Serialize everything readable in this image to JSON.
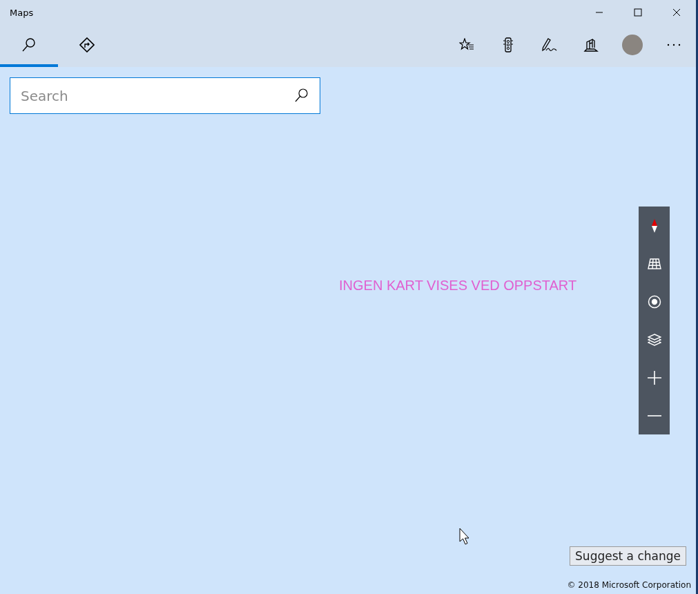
{
  "window": {
    "title": "Maps"
  },
  "tabs": [
    {
      "kind": "search",
      "selected": true
    },
    {
      "kind": "directions",
      "selected": false
    }
  ],
  "toolbar": [
    {
      "kind": "favorites"
    },
    {
      "kind": "traffic"
    },
    {
      "kind": "ink"
    },
    {
      "kind": "cities"
    },
    {
      "kind": "avatar"
    },
    {
      "kind": "more"
    }
  ],
  "search": {
    "placeholder": "Search"
  },
  "map": {
    "message": "INGEN KART VISES VED OPPSTART",
    "controls": [
      {
        "kind": "compass"
      },
      {
        "kind": "tilt"
      },
      {
        "kind": "location"
      },
      {
        "kind": "layers"
      },
      {
        "kind": "zoom-in"
      },
      {
        "kind": "zoom-out"
      }
    ],
    "suggest_button": "Suggest a change",
    "copyright": "© 2018 Microsoft Corporation"
  }
}
